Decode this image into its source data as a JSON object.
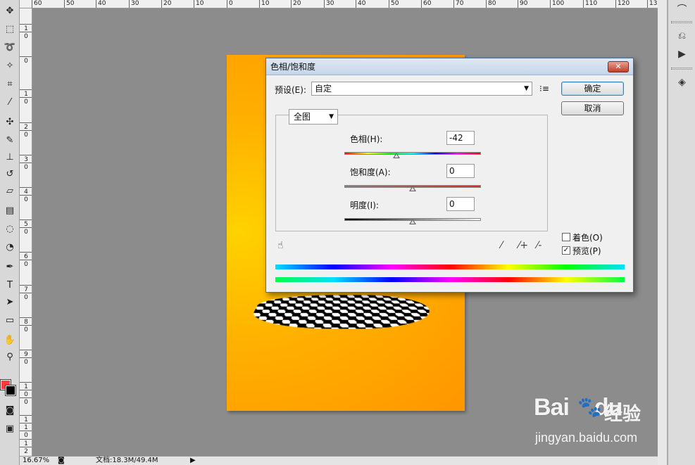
{
  "ruler_top": [
    "60",
    "50",
    "40",
    "30",
    "20",
    "10",
    "0",
    "10",
    "20",
    "30",
    "40",
    "50",
    "60",
    "70",
    "80",
    "90",
    "100",
    "110",
    "120",
    "13"
  ],
  "ruler_left": [
    "1",
    "0",
    "0",
    "1",
    "0",
    "2",
    "0",
    "3",
    "0",
    "4",
    "0",
    "5",
    "0",
    "6",
    "0",
    "7",
    "0",
    "8",
    "0",
    "9",
    "0",
    "1",
    "0",
    "0",
    "1",
    "1",
    "0",
    "1",
    "2"
  ],
  "status": {
    "zoom": "16.67%",
    "doc": "文档:18.3M/49.4M"
  },
  "dialog": {
    "title": "色相/饱和度",
    "close": "✕",
    "preset_label": "预设(E):",
    "preset_value": "自定",
    "preset_menu_icon": "list-menu-icon",
    "ok": "确定",
    "cancel": "取消",
    "channel": "全图",
    "hue_label": "色相(H):",
    "hue_value": "-42",
    "saturation_label": "饱和度(A):",
    "saturation_value": "0",
    "lightness_label": "明度(I):",
    "lightness_value": "0",
    "colorize_label": "着色(O)",
    "colorize_checked": false,
    "preview_label": "预览(P)",
    "preview_checked": true,
    "hue_slider_fraction": 0.383,
    "saturation_slider_fraction": 0.5,
    "lightness_slider_fraction": 0.5
  },
  "watermark": {
    "brand": "Bai",
    "brand2": "du",
    "cn": "经验",
    "url": "jingyan.baidu.com"
  },
  "colors": {
    "foreground": "#ff3b3b",
    "background": "#000000",
    "document_accent": "#ff9600"
  }
}
